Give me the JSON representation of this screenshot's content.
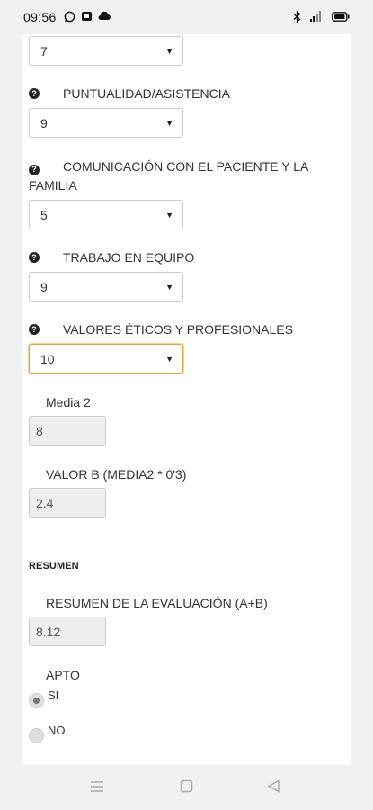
{
  "status_bar": {
    "time": "09:56",
    "icons_left": [
      "whatsapp-icon",
      "app-notification-icon",
      "cloud-icon"
    ],
    "icons_right": [
      "bluetooth-icon",
      "signal-icon",
      "battery-icon"
    ]
  },
  "form": {
    "field_top": {
      "value": "7"
    },
    "puntualidad": {
      "label": "PUNTUALIDAD/ASISTENCIA",
      "value": "9"
    },
    "comunicacion": {
      "label": "COMUNICACIÓN CON EL PACIENTE Y LA FAMILIA",
      "value": "5"
    },
    "trabajo": {
      "label": "TRABAJO EN EQUIPO",
      "value": "9"
    },
    "valores": {
      "label": "VALORES ÉTICOS Y PROFESIONALES",
      "value": "10"
    },
    "media2": {
      "label": "Media 2",
      "value": "8"
    },
    "valor_b": {
      "label": "VALOR B (MEDIA2 * 0'3)",
      "value": "2.4"
    },
    "resumen_title": "RESUMEN",
    "resumen": {
      "label": "RESUMEN DE LA EVALUACIÓN (A+B)",
      "value": "8.12"
    },
    "apto": {
      "label": "APTO",
      "options": [
        {
          "label": "SI",
          "selected": true
        },
        {
          "label": "NO",
          "selected": false
        }
      ]
    }
  },
  "nav_bar": {
    "buttons": [
      "menu-icon",
      "home-icon",
      "back-icon"
    ]
  }
}
